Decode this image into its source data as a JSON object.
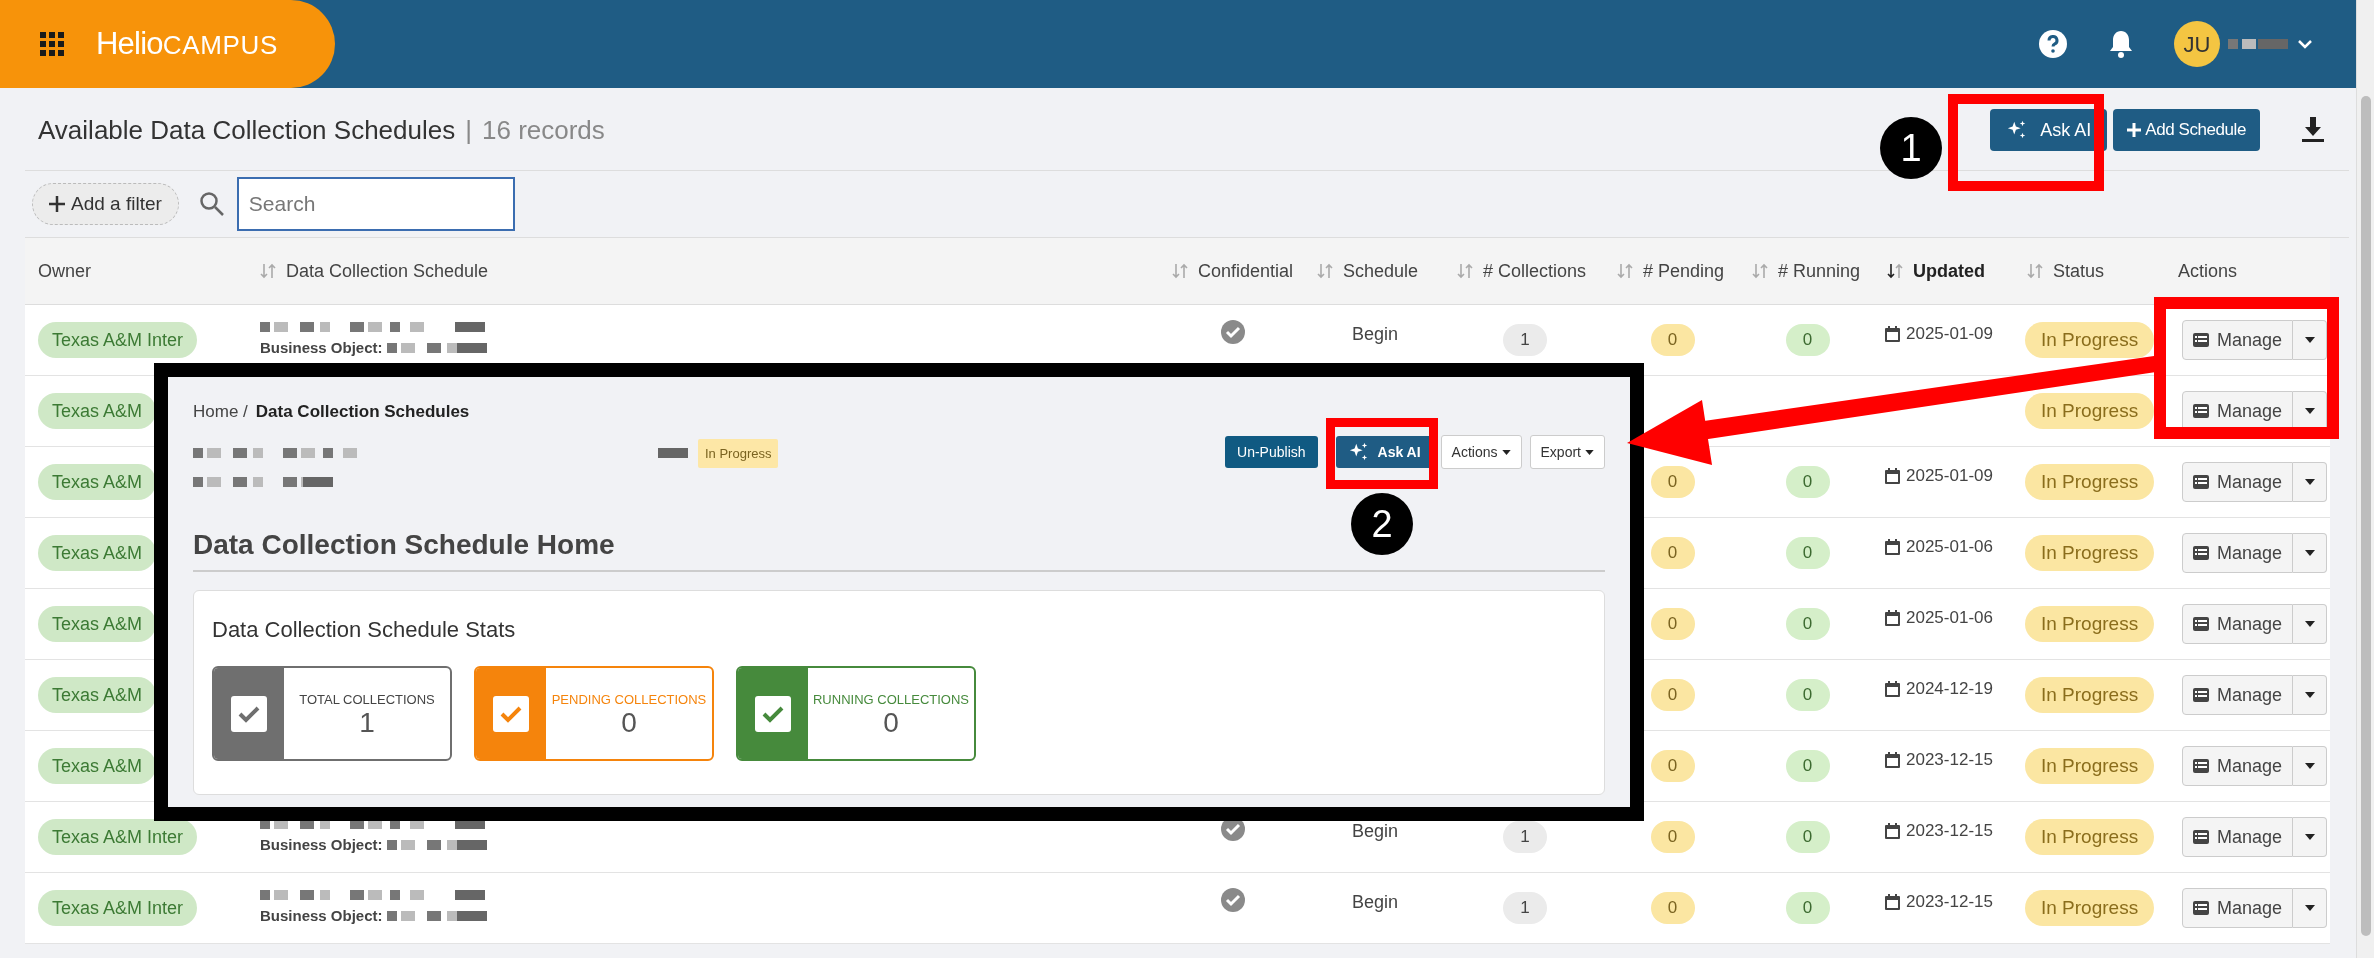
{
  "header": {
    "logo_primary": "Helio",
    "logo_secondary": "CAMPUS",
    "avatar_initials": "JU"
  },
  "page": {
    "title": "Available Data Collection Schedules",
    "separator": "|",
    "record_count": "16 records"
  },
  "toolbar": {
    "ask_ai": "Ask AI",
    "add_schedule": "Add Schedule",
    "add_filter": "Add a filter",
    "search_placeholder": "Search"
  },
  "table": {
    "columns": [
      {
        "label": "Owner",
        "sortable": false,
        "sorted": false
      },
      {
        "label": "Data Collection Schedule",
        "sortable": true,
        "sorted": false
      },
      {
        "label": "Confidential",
        "sortable": true,
        "sorted": false
      },
      {
        "label": "Schedule",
        "sortable": true,
        "sorted": false
      },
      {
        "label": "# Collections",
        "sortable": true,
        "sorted": false
      },
      {
        "label": "# Pending",
        "sortable": true,
        "sorted": false
      },
      {
        "label": "# Running",
        "sortable": true,
        "sorted": false
      },
      {
        "label": "Updated",
        "sortable": true,
        "sorted": true
      },
      {
        "label": "Status",
        "sortable": true,
        "sorted": false
      },
      {
        "label": "Actions",
        "sortable": false,
        "sorted": false
      }
    ],
    "rows": [
      {
        "owner": "Texas A&M Inter",
        "business_object_label": "Business Object:",
        "confidential": true,
        "schedule": "Begin",
        "collections": "1",
        "pending": "0",
        "running": "0",
        "updated": "2025-01-09",
        "status": "In Progress",
        "action": "Manage"
      },
      {
        "owner": "Texas A&M",
        "status": "In Progress",
        "action": "Manage"
      },
      {
        "owner": "Texas A&M",
        "pending": "0",
        "running": "0",
        "updated": "2025-01-09",
        "status": "In Progress",
        "action": "Manage"
      },
      {
        "owner": "Texas A&M",
        "pending": "0",
        "running": "0",
        "updated": "2025-01-06",
        "status": "In Progress",
        "action": "Manage"
      },
      {
        "owner": "Texas A&M",
        "pending": "0",
        "running": "0",
        "updated": "2025-01-06",
        "status": "In Progress",
        "action": "Manage"
      },
      {
        "owner": "Texas A&M",
        "pending": "0",
        "running": "0",
        "updated": "2024-12-19",
        "status": "In Progress",
        "action": "Manage"
      },
      {
        "owner": "Texas A&M",
        "pending": "0",
        "running": "0",
        "updated": "2023-12-15",
        "status": "In Progress",
        "action": "Manage"
      },
      {
        "owner": "Texas A&M Inter",
        "business_object_label": "Business Object:",
        "confidential": true,
        "schedule": "Begin",
        "collections": "1",
        "pending": "0",
        "running": "0",
        "updated": "2023-12-15",
        "status": "In Progress",
        "action": "Manage"
      },
      {
        "owner": "Texas A&M Inter",
        "business_object_label": "Business Object:",
        "confidential": true,
        "schedule": "Begin",
        "collections": "1",
        "pending": "0",
        "running": "0",
        "updated": "2023-12-15",
        "status": "In Progress",
        "action": "Manage"
      }
    ]
  },
  "inset": {
    "breadcrumb": [
      {
        "label": "Home /",
        "current": false
      },
      {
        "label": "Data Collection Schedules",
        "current": true
      }
    ],
    "status_badge": "In Progress",
    "buttons": [
      {
        "label": "Un-Publish",
        "kind": "primary"
      },
      {
        "label": "Ask AI",
        "kind": "ai"
      },
      {
        "label": "Actions",
        "kind": "dropdown"
      },
      {
        "label": "Export",
        "kind": "dropdown"
      }
    ],
    "section_title": "Data Collection Schedule Home",
    "stats_title": "Data Collection Schedule Stats",
    "stats": [
      {
        "label": "TOTAL COLLECTIONS",
        "value": "1",
        "color": "#6f6f6f"
      },
      {
        "label": "PENDING COLLECTIONS",
        "value": "0",
        "color": "#f5840c"
      },
      {
        "label": "RUNNING COLLECTIONS",
        "value": "0",
        "color": "#468a3c"
      }
    ]
  },
  "annotations": [
    {
      "label": "1"
    },
    {
      "label": "2"
    }
  ]
}
